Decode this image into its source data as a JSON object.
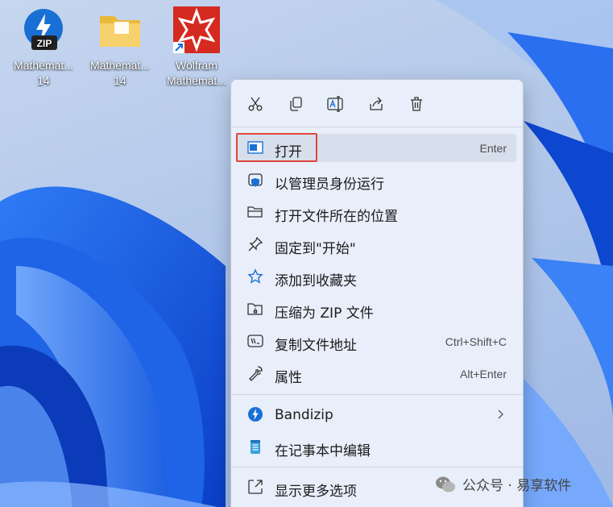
{
  "desktop": {
    "icons": [
      {
        "name": "Mathemat...",
        "subname": "14",
        "icon": "bandizip-zip-icon"
      },
      {
        "name": "Mathemat...",
        "subname": "14",
        "icon": "folder-icon"
      },
      {
        "name": "Wolfram",
        "subname": "Mathemat...",
        "icon": "wolfram-mathematica-icon"
      }
    ]
  },
  "context_menu": {
    "toolbar": [
      {
        "icon": "cut-icon"
      },
      {
        "icon": "copy-icon"
      },
      {
        "icon": "rename-icon"
      },
      {
        "icon": "share-icon"
      },
      {
        "icon": "delete-icon"
      }
    ],
    "items": [
      {
        "label": "打开",
        "shortcut": "Enter",
        "icon": "open-window-icon"
      },
      {
        "label": "以管理员身份运行",
        "shortcut": "",
        "icon": "admin-shield-icon"
      },
      {
        "label": "打开文件所在的位置",
        "shortcut": "",
        "icon": "folder-open-icon"
      },
      {
        "label": "固定到\"开始\"",
        "shortcut": "",
        "icon": "pin-icon"
      },
      {
        "label": "添加到收藏夹",
        "shortcut": "",
        "icon": "star-icon"
      },
      {
        "label": "压缩为 ZIP 文件",
        "shortcut": "",
        "icon": "zip-folder-icon"
      },
      {
        "label": "复制文件地址",
        "shortcut": "Ctrl+Shift+C",
        "icon": "copy-path-icon"
      },
      {
        "label": "属性",
        "shortcut": "Alt+Enter",
        "icon": "wrench-icon"
      },
      {
        "label": "Bandizip",
        "shortcut": "",
        "icon": "bandizip-icon"
      },
      {
        "label": "在记事本中编辑",
        "shortcut": "",
        "icon": "notepad-icon"
      },
      {
        "label": "显示更多选项",
        "shortcut": "",
        "icon": "show-more-icon"
      }
    ]
  },
  "watermark": {
    "text": "公众号 · 易享软件"
  },
  "colors": {
    "highlight_box": "#e0443a",
    "accent_blue": "#1a6fd4"
  }
}
